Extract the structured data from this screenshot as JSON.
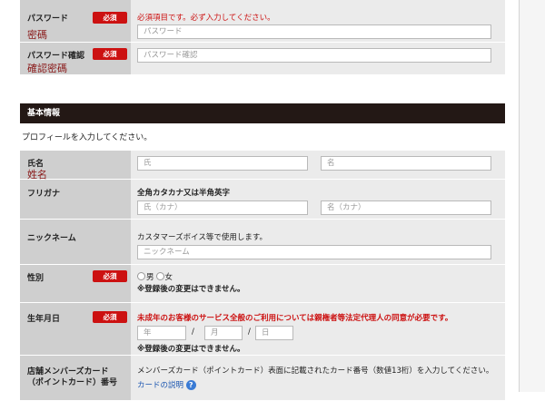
{
  "password": {
    "label": "パスワード",
    "cn": "密碼",
    "badge": "必須",
    "error": "必須項目です。必ず入力してください。",
    "placeholder": "パスワード"
  },
  "password_confirm": {
    "label": "パスワード確認",
    "cn": "確認密碼",
    "badge": "必須",
    "placeholder": "パスワード確認"
  },
  "section": {
    "title": "基本情報",
    "intro": "プロフィールを入力してください。"
  },
  "name": {
    "label": "氏名",
    "cn": "姓名",
    "last_placeholder": "氏",
    "first_placeholder": "名"
  },
  "furigana": {
    "label": "フリガナ",
    "note": "全角カタカナ又は半角英字",
    "last_placeholder": "氏（カナ）",
    "first_placeholder": "名（カナ）"
  },
  "nickname": {
    "label": "ニックネーム",
    "note": "カスタマーズボイス等で使用します。",
    "placeholder": "ニックネーム"
  },
  "gender": {
    "label": "性別",
    "badge": "必須",
    "male": "男",
    "female": "女",
    "note": "※登録後の変更はできません。"
  },
  "birthday": {
    "label": "生年月日",
    "badge": "必須",
    "warning": "未成年のお客様のサービス全般のご利用については親権者等法定代理人の同意が必要です。",
    "year": "年",
    "month": "月",
    "day": "日",
    "sep": "/",
    "note": "※登録後の変更はできません。"
  },
  "member_card": {
    "label_line1": "店舗メンバーズカード",
    "label_line2": "（ポイントカード）番号",
    "note": "メンバーズカード（ポイントカード）表面に記載されたカード番号（数値13桁）を入力してください。",
    "link": "カードの説明",
    "help": "?"
  },
  "colors": {
    "required_badge": "#cc1111",
    "section_bar": "#231815",
    "label_bg": "#cfcfcf",
    "field_bg": "#ebebeb"
  }
}
